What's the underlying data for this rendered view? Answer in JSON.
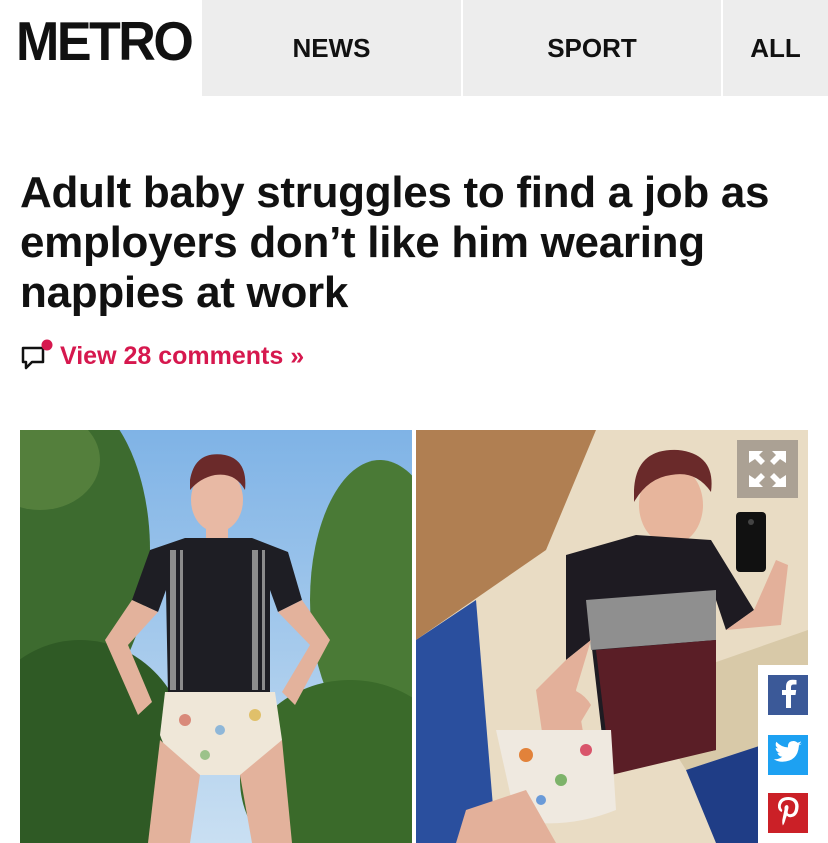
{
  "header": {
    "logo": "METRO",
    "nav": [
      {
        "label": "NEWS"
      },
      {
        "label": "SPORT"
      },
      {
        "label": "ALL"
      }
    ]
  },
  "article": {
    "headline": "Adult baby struggles to find a job as employers don’t like him wearing nappies at work",
    "comments_link": "View 28 comments »"
  },
  "icons": {
    "comment": "comment-bubble-icon",
    "expand": "expand-icon",
    "facebook": "facebook-icon",
    "twitter": "twitter-icon",
    "pinterest": "pinterest-icon"
  },
  "colors": {
    "accent": "#d6184e",
    "nav_bg": "#ededed",
    "facebook": "#3b5998",
    "twitter": "#1da1f2",
    "pinterest": "#cb2027"
  }
}
